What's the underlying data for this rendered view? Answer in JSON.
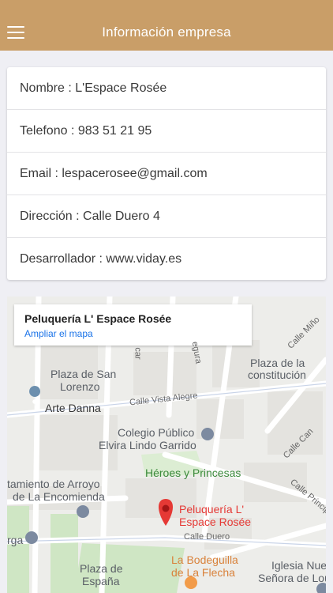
{
  "header": {
    "title": "Información empresa"
  },
  "company": {
    "rows": [
      "Nombre : L'Espace Rosée",
      "Telefono : 983 51 21 95",
      "Email : lespacerosee@gmail.com",
      "Dirección : Calle Duero 4",
      "Desarrollador : www.viday.es"
    ]
  },
  "map": {
    "info_title": "Peluquería L' Espace Rosée",
    "info_link": "Ampliar el mapa",
    "marker_label_line1": "Peluquería L'",
    "marker_label_line2": "Espace Rosée",
    "labels": {
      "plaza_san_lorenzo_1": "Plaza de San",
      "plaza_san_lorenzo_2": "Lorenzo",
      "arte_danna": "Arte Danna",
      "plaza_constitucion_1": "Plaza de la",
      "plaza_constitucion_2": "constitución",
      "colegio_1": "Colegio Público",
      "colegio_2": "Elvira Lindo Garrido",
      "heroes": "Héroes y Princesas",
      "ayuntamiento_1": "tamiento de Arroyo",
      "ayuntamiento_2": "de La Encomienda",
      "plaza_espana_1": "Plaza de",
      "plaza_espana_2": "España",
      "bodeguilla_1": "La Bodeguilla",
      "bodeguilla_2": "de La Flecha",
      "iglesia_1": "Iglesia Nue",
      "iglesia_2": "Señora de Lou",
      "calle_vista_alegre": "Calle Vista Alegre",
      "calle_duero": "Calle Duero",
      "calle_mino": "Calle Miño",
      "calle_can": "Calle Can",
      "calle_principal": "Calle Principal",
      "calle_segura": "egura",
      "calle_car": "car",
      "fragment_a": "a",
      "fragment_s": "s",
      "fragment_de": "de",
      "fragment_rga": "rga"
    }
  },
  "colors": {
    "header": "#c99e68",
    "marker": "#e53935",
    "link": "#1a73e8",
    "park": "#cfe6c4"
  }
}
